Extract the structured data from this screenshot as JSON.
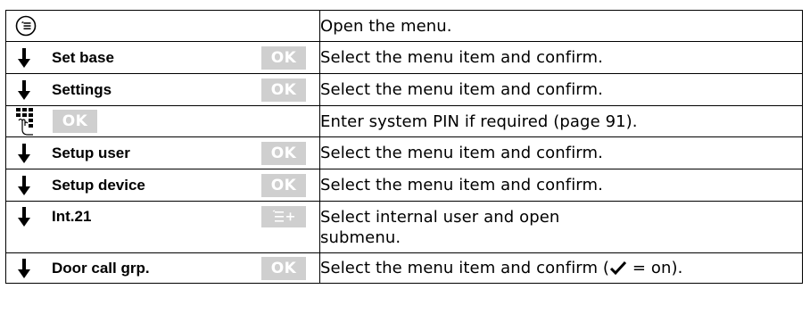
{
  "rows": [
    {
      "icon": "menu-icon",
      "label": "",
      "key": "",
      "desc": "Open the menu."
    },
    {
      "icon": "arrow-down-icon",
      "label": "Set base",
      "key": "OK",
      "desc": "Select the menu item and confirm."
    },
    {
      "icon": "arrow-down-icon",
      "label": "Settings",
      "key": "OK",
      "desc": "Select the menu item and confirm."
    },
    {
      "icon": "keypad-icon",
      "label": "",
      "key": "OK",
      "desc": "Enter system PIN if required (page 91)."
    },
    {
      "icon": "arrow-down-icon",
      "label": "Setup user",
      "key": "OK",
      "desc": "Select the menu item and confirm."
    },
    {
      "icon": "arrow-down-icon",
      "label": "Setup device",
      "key": "OK",
      "desc": "Select the menu item and confirm."
    },
    {
      "icon": "arrow-down-icon",
      "label": "Int.21",
      "key": "submenu-icon",
      "desc_line1": "Select internal user and open",
      "desc_line2": "submenu."
    },
    {
      "icon": "arrow-down-icon",
      "label": "Door call grp.",
      "key": "OK",
      "desc_prefix": "Select the menu item and confirm (",
      "desc_check_icon": "check-icon",
      "desc_suffix": " = on)."
    }
  ],
  "colors": {
    "softkey_bg": "#cfcfcf",
    "softkey_text": "#ffffff",
    "border": "#000000"
  }
}
